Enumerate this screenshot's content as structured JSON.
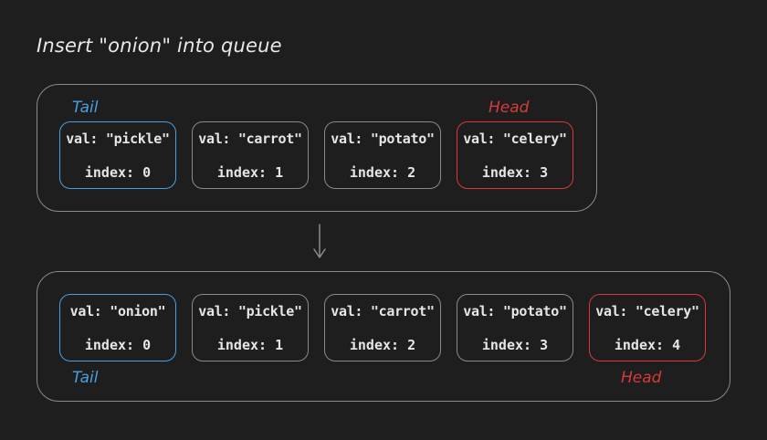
{
  "title": "Insert \"onion\" into queue",
  "before": {
    "tail_label": "Tail",
    "head_label": "Head",
    "nodes": [
      {
        "val": "val: \"pickle\"",
        "index": "index: 0"
      },
      {
        "val": "val: \"carrot\"",
        "index": "index: 1"
      },
      {
        "val": "val: \"potato\"",
        "index": "index: 2"
      },
      {
        "val": "val: \"celery\"",
        "index": "index: 3"
      }
    ]
  },
  "after": {
    "tail_label": "Tail",
    "head_label": "Head",
    "nodes": [
      {
        "val": "val: \"onion\"",
        "index": "index: 0"
      },
      {
        "val": "val: \"pickle\"",
        "index": "index: 1"
      },
      {
        "val": "val: \"carrot\"",
        "index": "index: 2"
      },
      {
        "val": "val: \"potato\"",
        "index": "index: 3"
      },
      {
        "val": "val: \"celery\"",
        "index": "index: 4"
      }
    ]
  },
  "colors": {
    "tail": "#4a9fe0",
    "head": "#d63a3a",
    "border": "#8a8a8a",
    "text": "#e6e6e6",
    "background": "#1e1e1e"
  },
  "icons": {
    "transition": "arrow-down-icon"
  }
}
